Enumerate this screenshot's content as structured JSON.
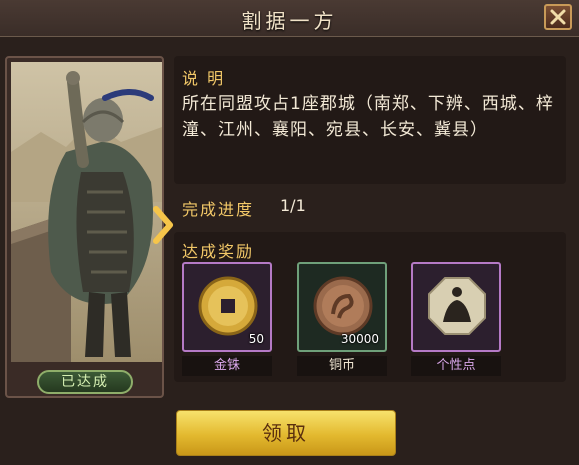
{
  "header": {
    "title": "割据一方",
    "close_icon": "close-icon"
  },
  "portrait": {
    "status_badge": "已达成"
  },
  "description": {
    "heading": "说 明",
    "body": "所在同盟攻占1座郡城（南郑、下辨、西城、梓潼、江州、襄阳、宛县、长安、冀县）"
  },
  "progress": {
    "label": "完成进度",
    "value": "1/1"
  },
  "rewards": {
    "heading": "达成奖励",
    "items": [
      {
        "name": "金铢",
        "quantity": "50",
        "icon": "gold-coin-icon",
        "frame_color": "#b57ac6",
        "name_color": "#d9a7ea"
      },
      {
        "name": "铜币",
        "quantity": "30000",
        "icon": "copper-coin-icon",
        "frame_color": "#6fa07a",
        "name_color": "#f0e6d2"
      },
      {
        "name": "个性点",
        "quantity": "",
        "icon": "trait-point-icon",
        "frame_color": "#b57ac6",
        "name_color": "#d9a7ea"
      }
    ]
  },
  "claim_button": {
    "label": "领取"
  },
  "colors": {
    "accent": "#f2c868",
    "button": "#e3b92f",
    "badge": "#8fae6a"
  }
}
